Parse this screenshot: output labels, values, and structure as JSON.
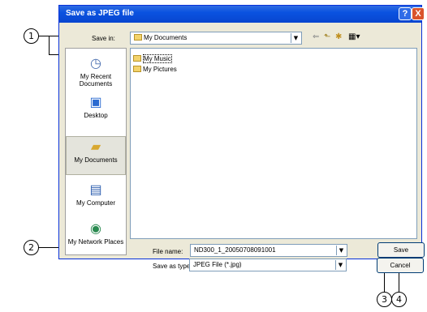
{
  "dialog": {
    "title": "Save as JPEG file",
    "help_glyph": "?",
    "close_glyph": "X"
  },
  "save_in": {
    "label": "Save in:",
    "value": "My Documents"
  },
  "toolbar": {
    "back_icon": "back-arrow-icon",
    "up_icon": "up-folder-icon",
    "new_folder_icon": "new-folder-icon",
    "views_icon": "views-menu-icon"
  },
  "places": [
    {
      "label": "My Recent Documents",
      "icon": "recent-documents-icon"
    },
    {
      "label": "Desktop",
      "icon": "desktop-icon"
    },
    {
      "label": "My Documents",
      "icon": "my-documents-icon"
    },
    {
      "label": "My Computer",
      "icon": "my-computer-icon"
    },
    {
      "label": "My Network Places",
      "icon": "network-places-icon"
    }
  ],
  "files": [
    {
      "name": "My Music"
    },
    {
      "name": "My Pictures"
    }
  ],
  "file_name": {
    "label": "File name:",
    "value": "ND300_1_20050708091001"
  },
  "save_type": {
    "label": "Save as type:",
    "value": "JPEG File (*.jpg)"
  },
  "buttons": {
    "save": "Save",
    "cancel": "Cancel"
  },
  "callouts": [
    "1",
    "2",
    "3",
    "4"
  ]
}
